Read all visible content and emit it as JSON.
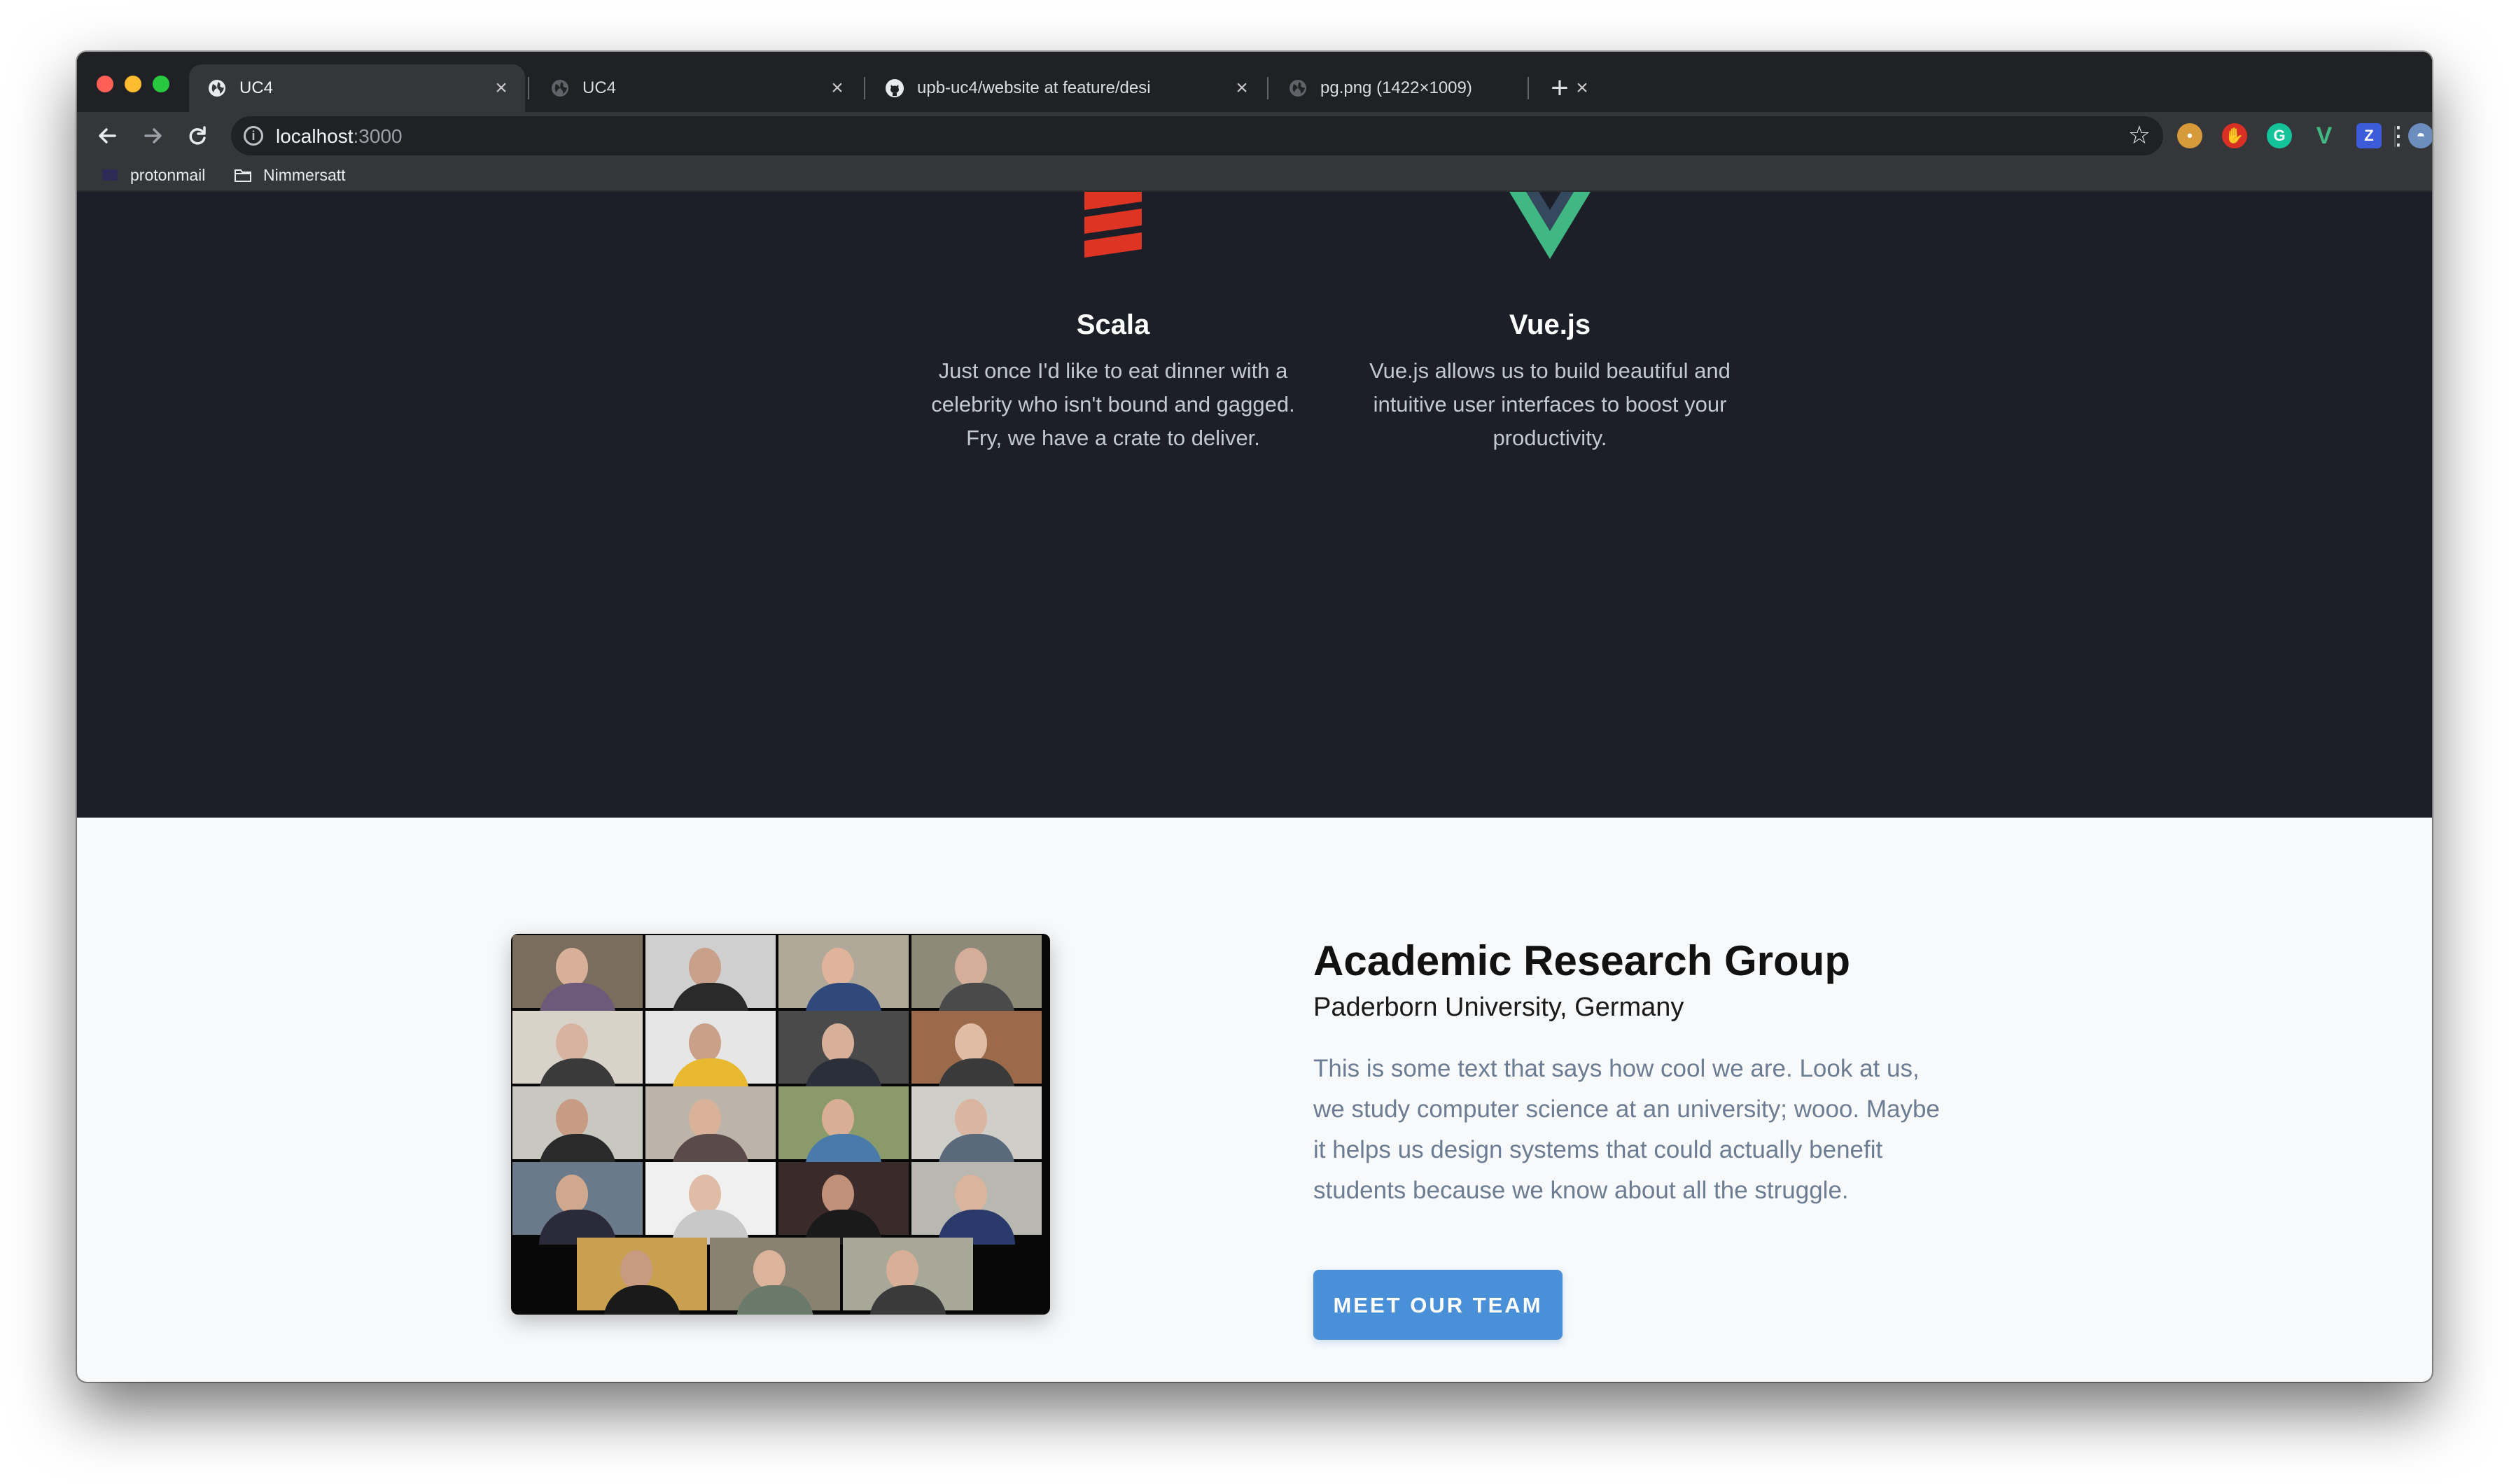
{
  "browser": {
    "tabs": [
      {
        "label": "UC4",
        "active": true,
        "icon": "globe-icon"
      },
      {
        "label": "UC4",
        "active": false,
        "icon": "globe-icon"
      },
      {
        "label": "upb-uc4/website at feature/desi",
        "active": false,
        "icon": "github-icon"
      },
      {
        "label": "pg.png (1422×1009)",
        "active": false,
        "icon": "globe-icon"
      }
    ],
    "tab_close_glyph": "×",
    "new_tab_glyph": "+",
    "url_host": "localhost",
    "url_port": ":3000",
    "bookmarks": [
      {
        "label": "protonmail",
        "icon": "protonmail-icon"
      },
      {
        "label": "Nimmersatt",
        "icon": "folder-icon"
      }
    ],
    "extensions": [
      {
        "name": "cookie-extension-icon",
        "color": "#d69a3a",
        "glyph": "◉"
      },
      {
        "name": "adblock-extension-icon",
        "color": "#d93025",
        "glyph": "✋"
      },
      {
        "name": "grammarly-extension-icon",
        "color": "#15c39a",
        "glyph": "G"
      },
      {
        "name": "vue-devtools-extension-icon",
        "color": "#41b883",
        "glyph": "V"
      },
      {
        "name": "z-extension-icon",
        "color": "#3b5bdb",
        "glyph": "Z"
      }
    ]
  },
  "tech_stack": [
    {
      "name": "Scala",
      "description": "Just once I'd like to eat dinner with a celebrity who isn't bound and gagged. Fry, we have a crate to deliver.",
      "icon": "scala-logo-icon",
      "color": "#de3423"
    },
    {
      "name": "Vue.js",
      "description": "Vue.js allows us to build beautiful and intuitive user interfaces to boost your productivity.",
      "icon": "vue-logo-icon",
      "color": "#41b883"
    }
  ],
  "research": {
    "title": "Academic Research Group",
    "subtitle": "Paderborn University, Germany",
    "text": "This is some text that says how cool we are. Look at us, we study computer science at an university; wooo. Maybe it helps us design systems that could actually benefit students because we know about all the struggle.",
    "button_label": "MEET OUR TEAM",
    "accent_color": "#4a90d9"
  }
}
